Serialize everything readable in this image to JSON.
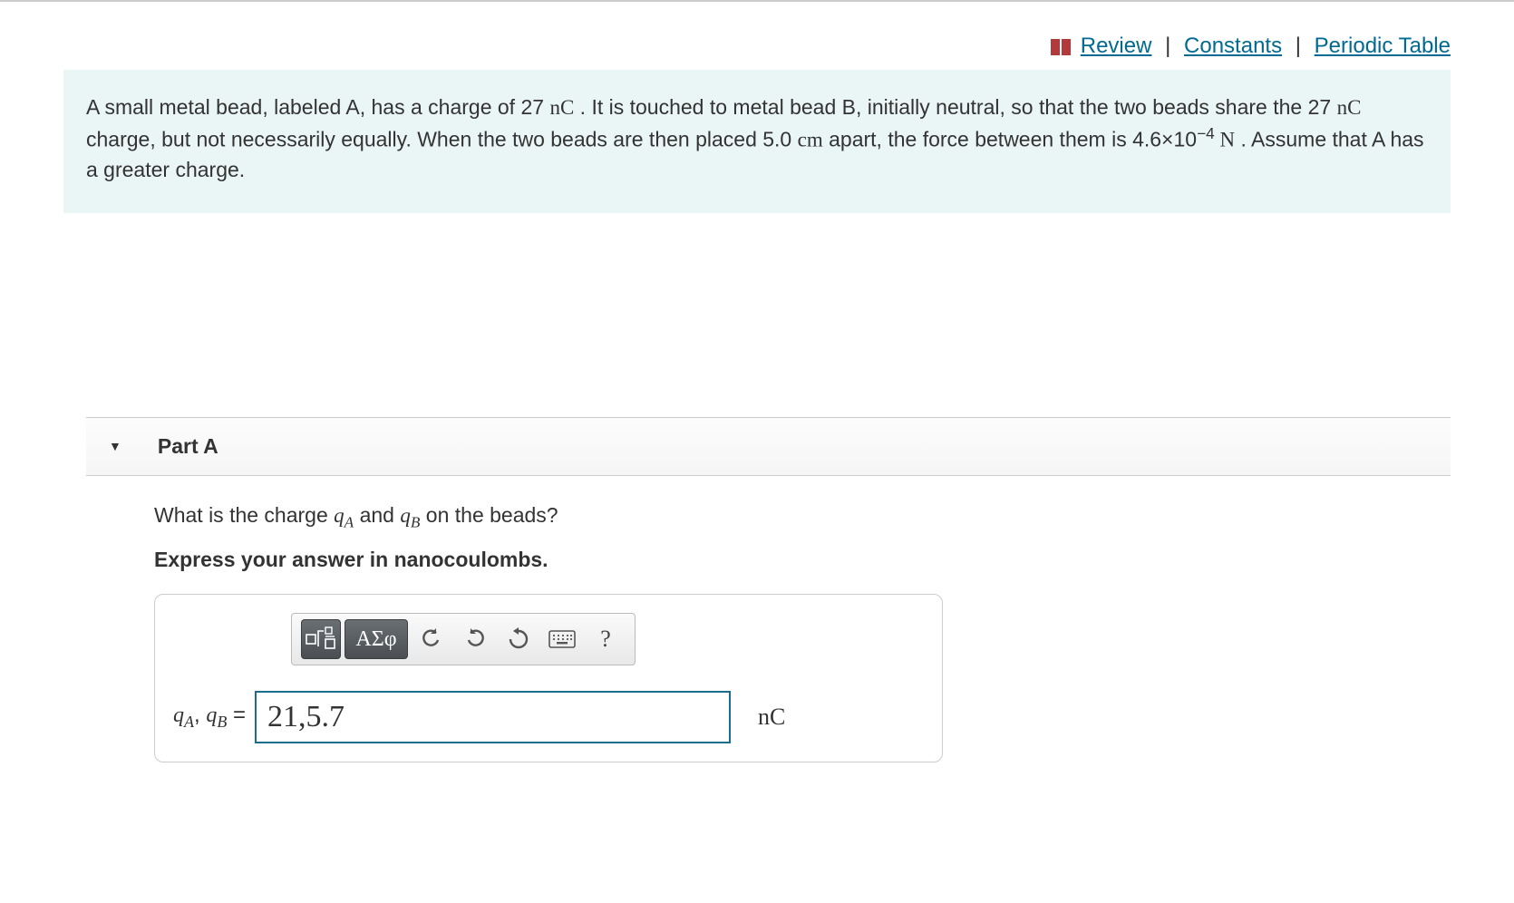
{
  "topLinks": {
    "review": "Review",
    "constants": "Constants",
    "periodicTable": "Periodic Table"
  },
  "problem": {
    "text_pre": "A small metal bead, labeled A, has a charge of 27 ",
    "unit1": "nC",
    "text_mid1": " . It is touched to metal bead B, initially neutral, so that the two beads share the 27 ",
    "unit2": "nC",
    "text_mid2": " charge, but not necessarily equally. When the two beads are then placed 5.0 ",
    "unit3": "cm",
    "text_mid3": " apart, the force between them is 4.6×10",
    "exp": "−4",
    "unit4": " N",
    "text_end": " . Assume that A has a greater charge."
  },
  "part": {
    "label": "Part A",
    "question_pre": "What is the charge ",
    "qA_sym": "q",
    "qA_sub": "A",
    "question_mid": " and ",
    "qB_sym": "q",
    "qB_sub": "B",
    "question_end": " on the beads?",
    "instruction": "Express your answer in nanocoulombs."
  },
  "toolbar": {
    "templates": "▢√▢",
    "greek": "ΑΣφ",
    "undo": "↶",
    "redo": "↷",
    "reset": "↻",
    "keyboard": "⌨",
    "help": "?"
  },
  "answer": {
    "lhs_q": "q",
    "lhs_subA": "A",
    "lhs_sep": ", ",
    "lhs_subB": "B",
    "lhs_eq": " = ",
    "value": "21,5.7",
    "unit": "nC"
  }
}
